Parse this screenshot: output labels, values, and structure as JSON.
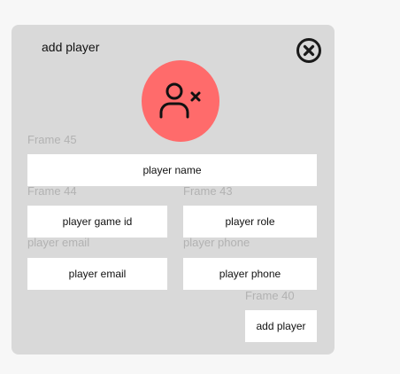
{
  "modal": {
    "title": "add player",
    "close_icon": "close-circle-icon",
    "avatar_icon": "user-remove-icon",
    "avatar_color": "#ff6b6b"
  },
  "frames": {
    "frame45": "Frame 45",
    "frame44": "Frame 44",
    "frame43": "Frame 43",
    "email_label": "player email",
    "phone_label": "player phone",
    "frame40": "Frame 40"
  },
  "fields": {
    "name_placeholder": "player name",
    "game_id_placeholder": "player game id",
    "role_placeholder": "player role",
    "email_placeholder": "player email",
    "phone_placeholder": "player phone"
  },
  "actions": {
    "add_player": "add player"
  }
}
